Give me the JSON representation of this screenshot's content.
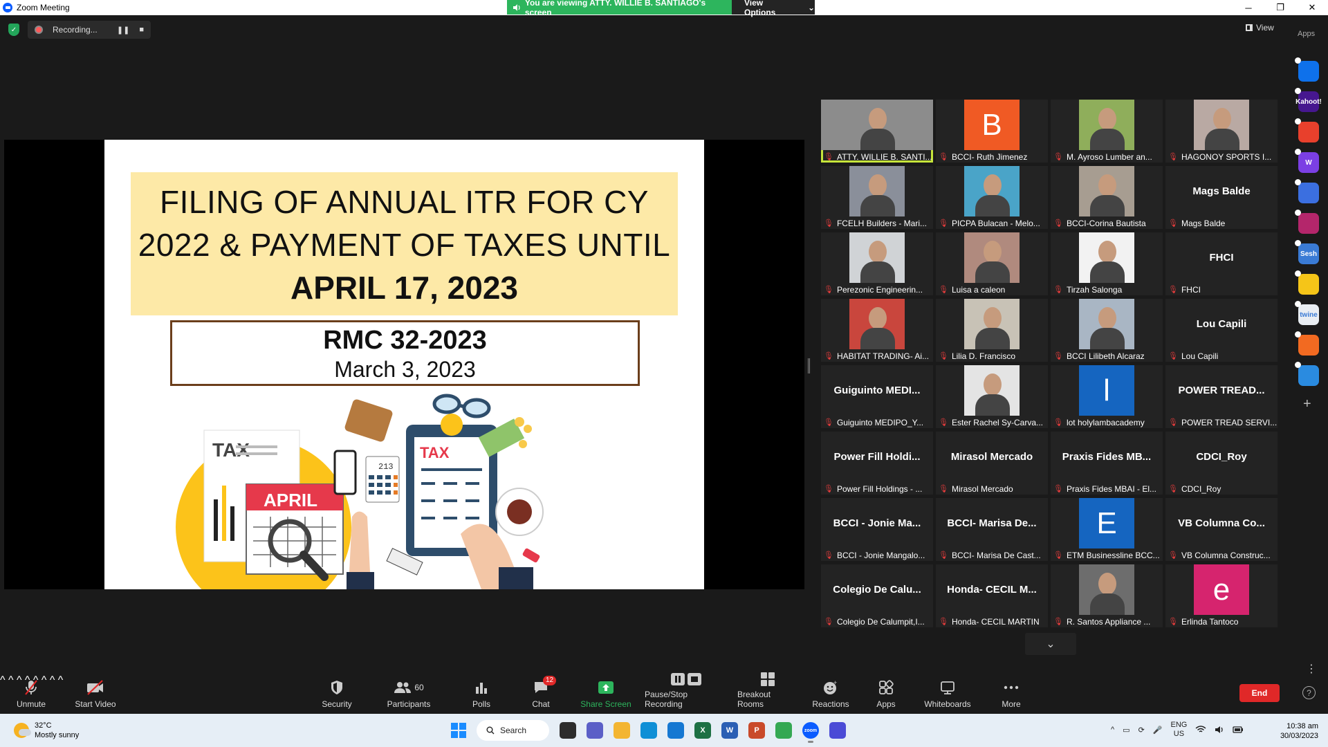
{
  "window": {
    "title": "Zoom Meeting",
    "controls": [
      "─",
      "❐",
      "✕"
    ]
  },
  "share_banner": {
    "text": "You are viewing ATTY. WILLIE B. SANTIAGO's screen",
    "view_options": "View Options",
    "view_options_caret": "⌄"
  },
  "recording": {
    "label": "Recording...",
    "pause_glyph": "❚❚",
    "stop_glyph": "■"
  },
  "view_button": "View",
  "apps_label": "Apps",
  "slide": {
    "title_line1": "FILING OF ANNUAL ITR FOR CY",
    "title_line2": "2022 & PAYMENT OF TAXES UNTIL",
    "title_line3": "APRIL 17, 2023",
    "rmc_number": "RMC 32-2023",
    "rmc_date": "March 3, 2023",
    "illus_tax_doc": "TAX",
    "illus_calendar_month": "APRIL",
    "illus_calculator_display": "213",
    "illus_clipboard": "TAX"
  },
  "gallery": {
    "tiles": [
      {
        "name": "ATTY. WILLIE B. SANTI...",
        "kind": "photo",
        "bg": "#8c8c8c",
        "active": true
      },
      {
        "name": "BCCI- Ruth Jimenez",
        "kind": "avatar",
        "letter": "B",
        "bg": "#f05a24"
      },
      {
        "name": "M. Ayroso Lumber an...",
        "kind": "photo",
        "bg": "#8fae5b"
      },
      {
        "name": "HAGONOY SPORTS I...",
        "kind": "photo",
        "bg": "#b9a9a3"
      },
      {
        "name": "FCELH Builders - Mari...",
        "kind": "photo",
        "bg": "#8a8f9a"
      },
      {
        "name": "PICPA Bulacan - Melo...",
        "kind": "photo",
        "bg": "#4aa4c8"
      },
      {
        "name": "BCCI-Corina Bautista",
        "kind": "photo",
        "bg": "#a79d91"
      },
      {
        "name": "Mags Balde",
        "kind": "text",
        "big": "Mags Balde"
      },
      {
        "name": "Perezonic Engineerin...",
        "kind": "photo",
        "bg": "#d0d3d6"
      },
      {
        "name": "Luisa a caleon",
        "kind": "photo",
        "bg": "#b08a7e"
      },
      {
        "name": "Tirzah Salonga",
        "kind": "photo",
        "bg": "#f2f2f2"
      },
      {
        "name": "FHCI",
        "kind": "text",
        "big": "FHCI"
      },
      {
        "name": "HABITAT TRADING- Ai...",
        "kind": "photo",
        "bg": "#c9463d"
      },
      {
        "name": "Lilia D. Francisco",
        "kind": "photo",
        "bg": "#c8c2b6"
      },
      {
        "name": "BCCI Lilibeth Alcaraz",
        "kind": "photo",
        "bg": "#a9b6c4"
      },
      {
        "name": "Lou  Capili",
        "kind": "text",
        "big": "Lou  Capili"
      },
      {
        "name": "Guiguinto MEDIPO_Y...",
        "kind": "text",
        "big": "Guiguinto  MEDI..."
      },
      {
        "name": "Ester Rachel Sy-Carva...",
        "kind": "photo",
        "bg": "#e4e4e4"
      },
      {
        "name": "lot holylambacademy",
        "kind": "avatar",
        "letter": "l",
        "bg": "#1565c0"
      },
      {
        "name": "POWER TREAD SERVI...",
        "kind": "text",
        "big": "POWER  TREAD..."
      },
      {
        "name": "Power Fill Holdings - ...",
        "kind": "text",
        "big": "Power  Fill  Holdi..."
      },
      {
        "name": "Mirasol Mercado",
        "kind": "text",
        "big": "Mirasol Mercado"
      },
      {
        "name": "Praxis Fides MBAI - El...",
        "kind": "text",
        "big": "Praxis  Fides  MB..."
      },
      {
        "name": "CDCI_Roy",
        "kind": "text",
        "big": "CDCI_Roy"
      },
      {
        "name": "BCCI - Jonie Mangalo...",
        "kind": "text",
        "big": "BCCI  -  Jonie  Ma..."
      },
      {
        "name": "BCCI- Marisa De Cast...",
        "kind": "text",
        "big": "BCCI-  Marisa  De..."
      },
      {
        "name": "ETM Businessline BCC...",
        "kind": "avatar",
        "letter": "E",
        "bg": "#1565c0"
      },
      {
        "name": "VB Columna Construc...",
        "kind": "text",
        "big": "VB  Columna  Co..."
      },
      {
        "name": "Colegio De Calumpit,I...",
        "kind": "text",
        "big": "Colegio  De  Calu..."
      },
      {
        "name": "Honda- CECIL MARTIN",
        "kind": "text",
        "big": "Honda-  CECIL  M..."
      },
      {
        "name": "R. Santos Appliance ...",
        "kind": "photo",
        "bg": "#6d6d6d"
      },
      {
        "name": "Erlinda Tantoco",
        "kind": "avatar",
        "letter": "e",
        "bg": "#d6246e"
      }
    ],
    "scroll_glyph": "⌄"
  },
  "apps_sidebar": [
    {
      "label": "",
      "bg": "#0e71eb"
    },
    {
      "label": "Kahoot!",
      "bg": "#46178f"
    },
    {
      "label": "",
      "bg": "#e8402c"
    },
    {
      "label": "W",
      "bg": "#7b3fe4"
    },
    {
      "label": "",
      "bg": "#3b6fe0"
    },
    {
      "label": "",
      "bg": "#b4266b"
    },
    {
      "label": "Sesh",
      "bg": "#3a7bd5"
    },
    {
      "label": "",
      "bg": "#f5c518"
    },
    {
      "label": "twine",
      "bg": "#e9eef3"
    },
    {
      "label": "",
      "bg": "#f26a21"
    },
    {
      "label": "",
      "bg": "#2a8be0"
    }
  ],
  "toolbar": {
    "unmute": "Unmute",
    "start_video": "Start Video",
    "security": "Security",
    "participants": "Participants",
    "participants_count": "60",
    "polls": "Polls",
    "chat": "Chat",
    "chat_badge": "12",
    "share_screen": "Share Screen",
    "pause_stop_recording": "Pause/Stop Recording",
    "breakout_rooms": "Breakout Rooms",
    "reactions": "Reactions",
    "apps": "Apps",
    "whiteboards": "Whiteboards",
    "more": "More",
    "end": "End",
    "caret": "^",
    "more_glyph": "⋮",
    "help_glyph": "?"
  },
  "taskbar": {
    "temp": "32°C",
    "weather": "Mostly sunny",
    "search": "Search",
    "lang_top": "ENG",
    "lang_bottom": "US",
    "time": "10:38 am",
    "date": "30/03/2023",
    "apps": [
      {
        "label": "",
        "bg": "#2c2c2c"
      },
      {
        "label": "",
        "bg": "#5b5fc7"
      },
      {
        "label": "",
        "bg": "#f3b531"
      },
      {
        "label": "",
        "bg": "#0f8fd6"
      },
      {
        "label": "",
        "bg": "#1678d2"
      },
      {
        "label": "X",
        "bg": "#1d7044"
      },
      {
        "label": "W",
        "bg": "#2b5fb4"
      },
      {
        "label": "P",
        "bg": "#c94a2a"
      },
      {
        "label": "",
        "bg": "#34a853"
      },
      {
        "label": "zoom",
        "bg": "#0b5cff"
      },
      {
        "label": "",
        "bg": "#4b4bd6"
      }
    ],
    "tray_glyphs": [
      "^",
      "▭",
      "⟳",
      "🎤"
    ]
  }
}
